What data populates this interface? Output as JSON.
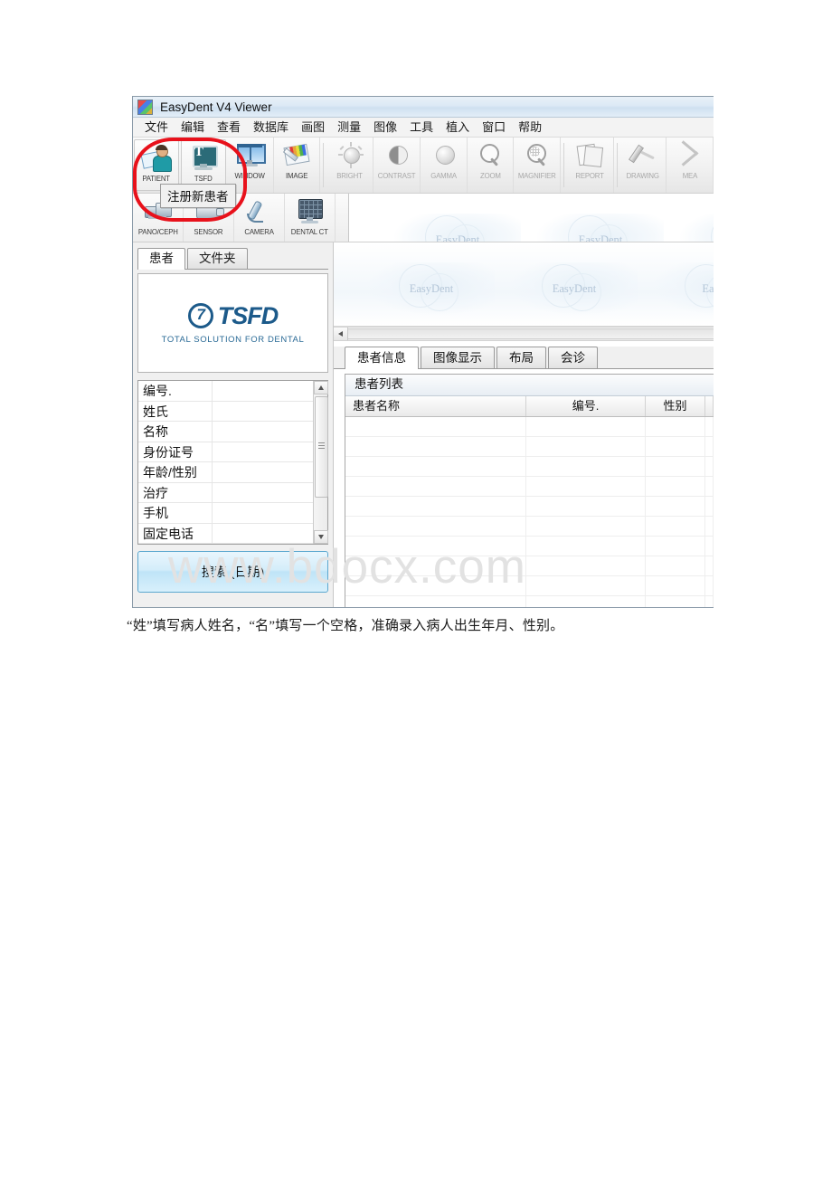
{
  "window": {
    "title": "EasyDent V4 Viewer",
    "title_icon": "app-icon"
  },
  "menubar": {
    "items": [
      {
        "label": "文件"
      },
      {
        "label": "编辑"
      },
      {
        "label": "查看"
      },
      {
        "label": "数据库"
      },
      {
        "label": "画图"
      },
      {
        "label": "测量"
      },
      {
        "label": "图像"
      },
      {
        "label": "工具"
      },
      {
        "label": "植入"
      },
      {
        "label": "窗口"
      },
      {
        "label": "帮助"
      }
    ]
  },
  "toolbar_row1": {
    "buttons": [
      {
        "label": "PATIENT",
        "icon": "patient-card-icon",
        "enabled": true
      },
      {
        "label": "TSFD",
        "icon": "monitor-t-icon",
        "enabled": true
      },
      {
        "label": "WINDOW",
        "icon": "window-icon",
        "enabled": true
      },
      {
        "label": "IMAGE",
        "icon": "image-palette-icon",
        "enabled": true
      },
      {
        "label": "BRIGHT",
        "icon": "brightness-sun-icon",
        "enabled": false
      },
      {
        "label": "CONTRAST",
        "icon": "contrast-half-circle-icon",
        "enabled": false
      },
      {
        "label": "GAMMA",
        "icon": "gamma-sphere-icon",
        "enabled": false
      },
      {
        "label": "ZOOM",
        "icon": "magnifier-icon",
        "enabled": false
      },
      {
        "label": "MAGNIFIER",
        "icon": "magnifier-grid-icon",
        "enabled": false
      },
      {
        "label": "REPORT",
        "icon": "report-pages-icon",
        "enabled": false
      },
      {
        "label": "DRAWING",
        "icon": "pen-icon",
        "enabled": false
      },
      {
        "label": "MEA",
        "icon": "ruler-caliper-icon",
        "enabled": false
      }
    ]
  },
  "toolbar_row2": {
    "buttons": [
      {
        "label": "PANO/CEPH",
        "icon": "xray-machine-icon"
      },
      {
        "label": "SENSOR",
        "icon": "sensor-icon"
      },
      {
        "label": "CAMERA",
        "icon": "intraoral-camera-icon"
      },
      {
        "label": "DENTAL CT",
        "icon": "dental-ct-icon"
      }
    ]
  },
  "tooltip": {
    "text": "注册新患者"
  },
  "left_panel": {
    "tabs": [
      {
        "label": "患者",
        "active": true
      },
      {
        "label": "文件夹",
        "active": false
      }
    ],
    "logo": {
      "mark": "7",
      "name": "TSFD",
      "tagline": "TOTAL SOLUTION FOR DENTAL"
    },
    "fields": [
      {
        "label": "编号.",
        "value": ""
      },
      {
        "label": "姓氏",
        "value": ""
      },
      {
        "label": "名称",
        "value": ""
      },
      {
        "label": "身份证号",
        "value": ""
      },
      {
        "label": "年龄/性别",
        "value": ""
      },
      {
        "label": "治疗",
        "value": ""
      },
      {
        "label": "手机",
        "value": ""
      },
      {
        "label": "固定电话",
        "value": ""
      }
    ],
    "search_button": "搜索 (日期)"
  },
  "preview_strip": {
    "watermarks": [
      "EasyDent",
      "EasyDent",
      "EasyD"
    ]
  },
  "right_panel": {
    "tabs": [
      {
        "label": "患者信息",
        "active": true
      },
      {
        "label": "图像显示",
        "active": false
      },
      {
        "label": "布局",
        "active": false
      },
      {
        "label": "会诊",
        "active": false
      }
    ],
    "list_caption": "患者列表",
    "columns": [
      {
        "label": "患者名称"
      },
      {
        "label": "编号."
      },
      {
        "label": "性别"
      },
      {
        "label": ""
      }
    ],
    "rows": []
  },
  "page_watermark": "www.bdocx.com",
  "caption": "“姓”填写病人姓名，“名”填写一个空格，准确录入病人出生年月、性别。",
  "colors": {
    "annotation_red": "#e8111b",
    "brand_blue": "#1c5a8a",
    "search_button_blue": "#bfe4f7"
  }
}
